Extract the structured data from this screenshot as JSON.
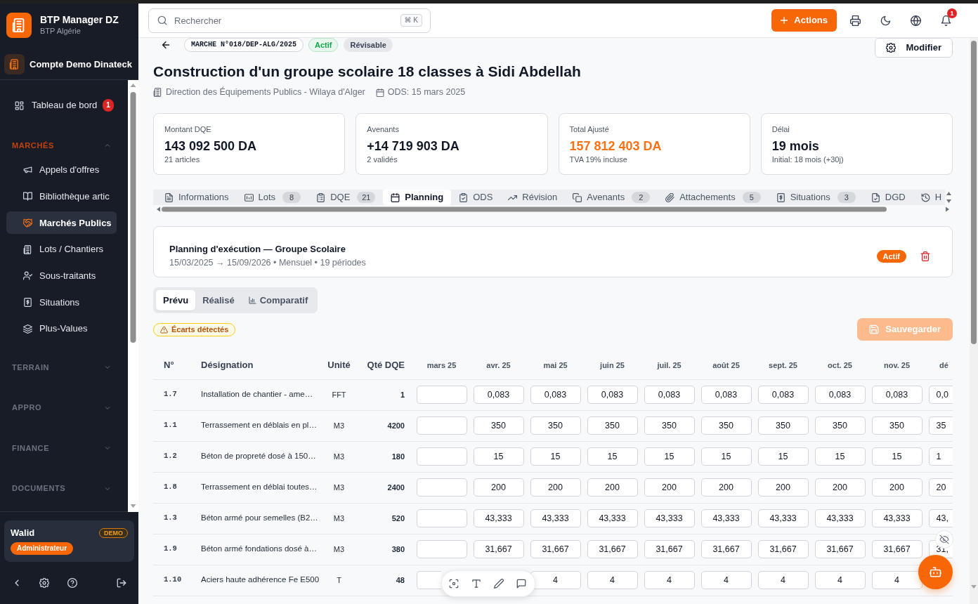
{
  "sidebar": {
    "brand": {
      "name": "BTP Manager DZ",
      "subtitle": "BTP Algérie"
    },
    "account": "Compte Demo Dinateck",
    "items": [
      {
        "label": "Tableau de bord",
        "badge": "1",
        "selected": false
      }
    ],
    "sections": [
      {
        "title": "MARCHÉS",
        "expanded": true,
        "items": [
          {
            "label": "Appels d'offres",
            "selected": false
          },
          {
            "label": "Bibliothèque artic",
            "selected": false
          },
          {
            "label": "Marchés Publics",
            "selected": true
          },
          {
            "label": "Lots / Chantiers",
            "selected": false
          },
          {
            "label": "Sous-traitants",
            "selected": false
          },
          {
            "label": "Situations",
            "selected": false
          },
          {
            "label": "Plus-Values",
            "selected": false
          }
        ]
      },
      {
        "title": "TERRAIN",
        "expanded": false
      },
      {
        "title": "APPRO",
        "expanded": false
      },
      {
        "title": "FINANCE",
        "expanded": false
      },
      {
        "title": "DOCUMENTS",
        "expanded": false
      }
    ],
    "user": {
      "name": "Walid",
      "tag": "DEMO",
      "role": "Administrateur"
    }
  },
  "topbar": {
    "search": {
      "placeholder": "Rechercher",
      "shortcut": "⌘ K"
    },
    "actions": "Actions",
    "notifications": "1"
  },
  "contract": {
    "reference": "MARCHE N°018/DEP-ALG/2025",
    "statuses": [
      {
        "label": "Actif",
        "kind": "success"
      },
      {
        "label": "Révisable",
        "kind": "neutral"
      }
    ],
    "edit_button": "Modifier",
    "title": "Construction d'un groupe scolaire 18 classes à Sidi Abdellah",
    "client": "Direction des Équipements Publics - Wilaya d'Alger",
    "ods": "ODS: 15 mars 2025"
  },
  "stats": [
    {
      "label": "Montant DQE",
      "value": "143 092 500 DA",
      "note": "21 articles",
      "highlight": false
    },
    {
      "label": "Avenants",
      "value": "+14 719 903 DA",
      "note": "2 validés",
      "highlight": false
    },
    {
      "label": "Total Ajusté",
      "value": "157 812 403 DA",
      "note": "TVA 19% incluse",
      "highlight": true
    },
    {
      "label": "Délai",
      "value": "19 mois",
      "note": "Initial: 18 mois (+30j)",
      "highlight": false
    }
  ],
  "tabs": [
    {
      "label": "Informations",
      "selected": false
    },
    {
      "label": "Lots",
      "count": "8",
      "selected": false
    },
    {
      "label": "DQE",
      "count": "21",
      "selected": false
    },
    {
      "label": "Planning",
      "selected": true
    },
    {
      "label": "ODS",
      "selected": false
    },
    {
      "label": "Révision",
      "selected": false
    },
    {
      "label": "Avenants",
      "count": "2",
      "selected": false
    },
    {
      "label": "Attachements",
      "count": "5",
      "selected": false
    },
    {
      "label": "Situations",
      "count": "3",
      "selected": false
    },
    {
      "label": "DGD",
      "selected": false
    },
    {
      "label": "H",
      "selected": false
    }
  ],
  "planning": {
    "title": "Planning d'exécution — Groupe Scolaire",
    "summary": "15/03/2025 → 15/09/2026 • Mensuel • 19 périodes",
    "status": "Actif"
  },
  "views": [
    {
      "label": "Prévu",
      "selected": true
    },
    {
      "label": "Réalisé",
      "selected": false
    },
    {
      "label": "Comparatif",
      "selected": false
    }
  ],
  "alert": "Écarts détectés",
  "save_button": {
    "label": "Sauvegarder",
    "disabled": true
  },
  "table": {
    "columns": [
      "N°",
      "Désignation",
      "Unité",
      "Qté DQE"
    ],
    "periods": [
      "mars 25",
      "avr. 25",
      "mai 25",
      "juin 25",
      "juil. 25",
      "août 25",
      "sept. 25",
      "oct. 25",
      "nov. 25",
      "dé"
    ],
    "rows": [
      {
        "number": "1.7",
        "designation": "Installation de chantier - ame…",
        "unit": "FFT",
        "quantity": "1",
        "cells": [
          {
            "kind": "blank"
          },
          {
            "kind": "value",
            "text": "0,083"
          },
          {
            "kind": "value",
            "text": "0,083"
          },
          {
            "kind": "value",
            "text": "0,083"
          },
          {
            "kind": "value",
            "text": "0,083"
          },
          {
            "kind": "value",
            "text": "0,083"
          },
          {
            "kind": "value",
            "text": "0,083"
          },
          {
            "kind": "value",
            "text": "0,083"
          },
          {
            "kind": "value",
            "text": "0,083"
          },
          {
            "kind": "value",
            "text": "0,0"
          }
        ]
      },
      {
        "number": "1.1",
        "designation": "Terrassement en déblais en pl…",
        "unit": "M3",
        "quantity": "4200",
        "cells": [
          {
            "kind": "blank"
          },
          {
            "kind": "value",
            "text": "350"
          },
          {
            "kind": "value",
            "text": "350"
          },
          {
            "kind": "value",
            "text": "350"
          },
          {
            "kind": "value",
            "text": "350"
          },
          {
            "kind": "value",
            "text": "350"
          },
          {
            "kind": "value",
            "text": "350"
          },
          {
            "kind": "value",
            "text": "350"
          },
          {
            "kind": "value",
            "text": "350"
          },
          {
            "kind": "value",
            "text": "35"
          }
        ]
      },
      {
        "number": "1.2",
        "designation": "Béton de propreté dosé à 150…",
        "unit": "M3",
        "quantity": "180",
        "cells": [
          {
            "kind": "blank"
          },
          {
            "kind": "value",
            "text": "15"
          },
          {
            "kind": "value",
            "text": "15"
          },
          {
            "kind": "value",
            "text": "15"
          },
          {
            "kind": "value",
            "text": "15"
          },
          {
            "kind": "value",
            "text": "15"
          },
          {
            "kind": "value",
            "text": "15"
          },
          {
            "kind": "value",
            "text": "15"
          },
          {
            "kind": "value",
            "text": "15"
          },
          {
            "kind": "value",
            "text": "1"
          }
        ]
      },
      {
        "number": "1.8",
        "designation": "Terrassement en déblai toutes…",
        "unit": "M3",
        "quantity": "2400",
        "cells": [
          {
            "kind": "blank"
          },
          {
            "kind": "value",
            "text": "200"
          },
          {
            "kind": "value",
            "text": "200"
          },
          {
            "kind": "value",
            "text": "200"
          },
          {
            "kind": "value",
            "text": "200"
          },
          {
            "kind": "value",
            "text": "200"
          },
          {
            "kind": "value",
            "text": "200"
          },
          {
            "kind": "value",
            "text": "200"
          },
          {
            "kind": "value",
            "text": "200"
          },
          {
            "kind": "value",
            "text": "20"
          }
        ]
      },
      {
        "number": "1.3",
        "designation": "Béton armé pour semelles (B2…",
        "unit": "M3",
        "quantity": "520",
        "cells": [
          {
            "kind": "blank"
          },
          {
            "kind": "value",
            "text": "43,333"
          },
          {
            "kind": "value",
            "text": "43,333"
          },
          {
            "kind": "value",
            "text": "43,333"
          },
          {
            "kind": "value",
            "text": "43,333"
          },
          {
            "kind": "value",
            "text": "43,333"
          },
          {
            "kind": "value",
            "text": "43,333"
          },
          {
            "kind": "value",
            "text": "43,333"
          },
          {
            "kind": "value",
            "text": "43,333"
          },
          {
            "kind": "value",
            "text": "43,"
          }
        ]
      },
      {
        "number": "1.9",
        "designation": "Béton armé fondations dosé à…",
        "unit": "M3",
        "quantity": "380",
        "cells": [
          {
            "kind": "blank"
          },
          {
            "kind": "value",
            "text": "31,667"
          },
          {
            "kind": "value",
            "text": "31,667"
          },
          {
            "kind": "value",
            "text": "31,667"
          },
          {
            "kind": "value",
            "text": "31,667"
          },
          {
            "kind": "value",
            "text": "31,667"
          },
          {
            "kind": "value",
            "text": "31,667"
          },
          {
            "kind": "value",
            "text": "31,667"
          },
          {
            "kind": "value",
            "text": "31,667"
          },
          {
            "kind": "value",
            "text": "31,"
          }
        ]
      },
      {
        "number": "1.10",
        "designation": "Aciers haute adhérence Fe E500",
        "unit": "T",
        "quantity": "48",
        "cells": [
          {
            "kind": "blank"
          },
          {
            "kind": "covered"
          },
          {
            "kind": "value",
            "text": "4"
          },
          {
            "kind": "value",
            "text": "4"
          },
          {
            "kind": "value",
            "text": "4"
          },
          {
            "kind": "value",
            "text": "4"
          },
          {
            "kind": "value",
            "text": "4"
          },
          {
            "kind": "value",
            "text": "4"
          },
          {
            "kind": "value",
            "text": "4"
          },
          {
            "kind": "covered"
          }
        ]
      }
    ]
  }
}
